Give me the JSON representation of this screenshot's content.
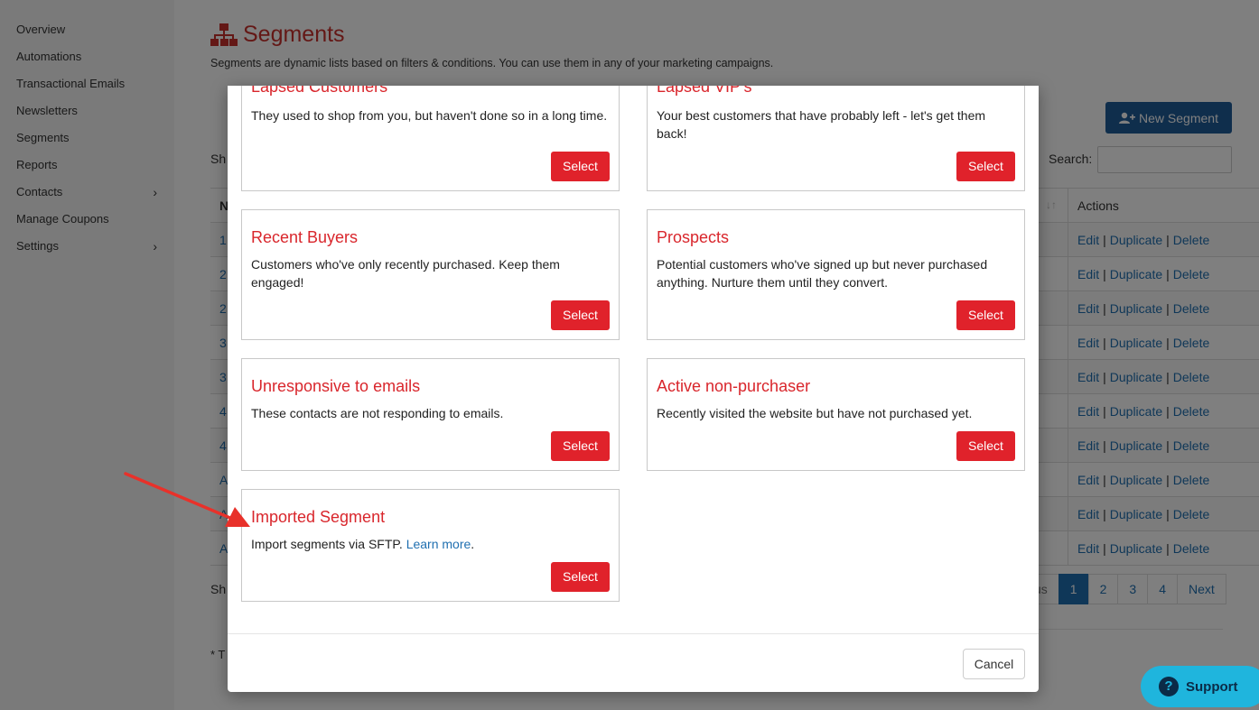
{
  "sidebar": {
    "items": [
      {
        "label": "Overview",
        "has_submenu": false
      },
      {
        "label": "Automations",
        "has_submenu": false
      },
      {
        "label": "Transactional Emails",
        "has_submenu": false
      },
      {
        "label": "Newsletters",
        "has_submenu": false
      },
      {
        "label": "Segments",
        "has_submenu": false
      },
      {
        "label": "Reports",
        "has_submenu": false
      },
      {
        "label": "Contacts",
        "has_submenu": true
      },
      {
        "label": "Manage Coupons",
        "has_submenu": false
      },
      {
        "label": "Settings",
        "has_submenu": true
      }
    ],
    "chevron": "›"
  },
  "page": {
    "title": "Segments",
    "icon": "sitemap-icon",
    "description": "Segments are dynamic lists based on filters & conditions. You can use them in any of your marketing campaigns.",
    "new_segment_label": "New Segment",
    "search_label": "Search:",
    "show_top_partial": "Sh",
    "show_bottom_partial": "Sh",
    "footnote_partial": "* T"
  },
  "table": {
    "name_header_partial": "N",
    "actions_header": "Actions",
    "sort_glyph": "↓↑",
    "row_prefixes": [
      "1",
      "2",
      "2",
      "3",
      "3",
      "4",
      "4",
      "A",
      "A",
      "A"
    ],
    "actions": {
      "edit": "Edit",
      "duplicate": "Duplicate",
      "delete": "Delete",
      "separator": "|"
    }
  },
  "pagination": {
    "prev_partial": "us",
    "pages": [
      "1",
      "2",
      "3",
      "4"
    ],
    "active_page": "1",
    "next": "Next"
  },
  "modal": {
    "cards": [
      {
        "title": "Lapsed Customers",
        "description": "They used to shop from you, but haven't done so in a long time.",
        "button": "Select"
      },
      {
        "title": "Lapsed VIP's",
        "description": "Your best customers that have probably left - let's get them back!",
        "button": "Select"
      },
      {
        "title": "Recent Buyers",
        "description": "Customers who've only recently purchased. Keep them engaged!",
        "button": "Select"
      },
      {
        "title": "Prospects",
        "description": "Potential customers who've signed up but never purchased anything. Nurture them until they convert.",
        "button": "Select"
      },
      {
        "title": "Unresponsive to emails",
        "description": "These contacts are not responding to emails.",
        "button": "Select"
      },
      {
        "title": "Active non-purchaser",
        "description": "Recently visited the website but have not purchased yet.",
        "button": "Select"
      },
      {
        "title": "Imported Segment",
        "description": "Import segments via SFTP.",
        "link": "Learn more",
        "after_link": ".",
        "button": "Select"
      }
    ],
    "cancel_label": "Cancel"
  },
  "support": {
    "label": "Support",
    "icon_glyph": "?"
  },
  "colors": {
    "accent_red": "#d9262c",
    "button_red": "#e0222b",
    "link_blue": "#1f6fb0",
    "new_segment_blue": "#1f5c99",
    "support_cyan": "#1fb5dd",
    "arrow_red": "#e8312a"
  }
}
